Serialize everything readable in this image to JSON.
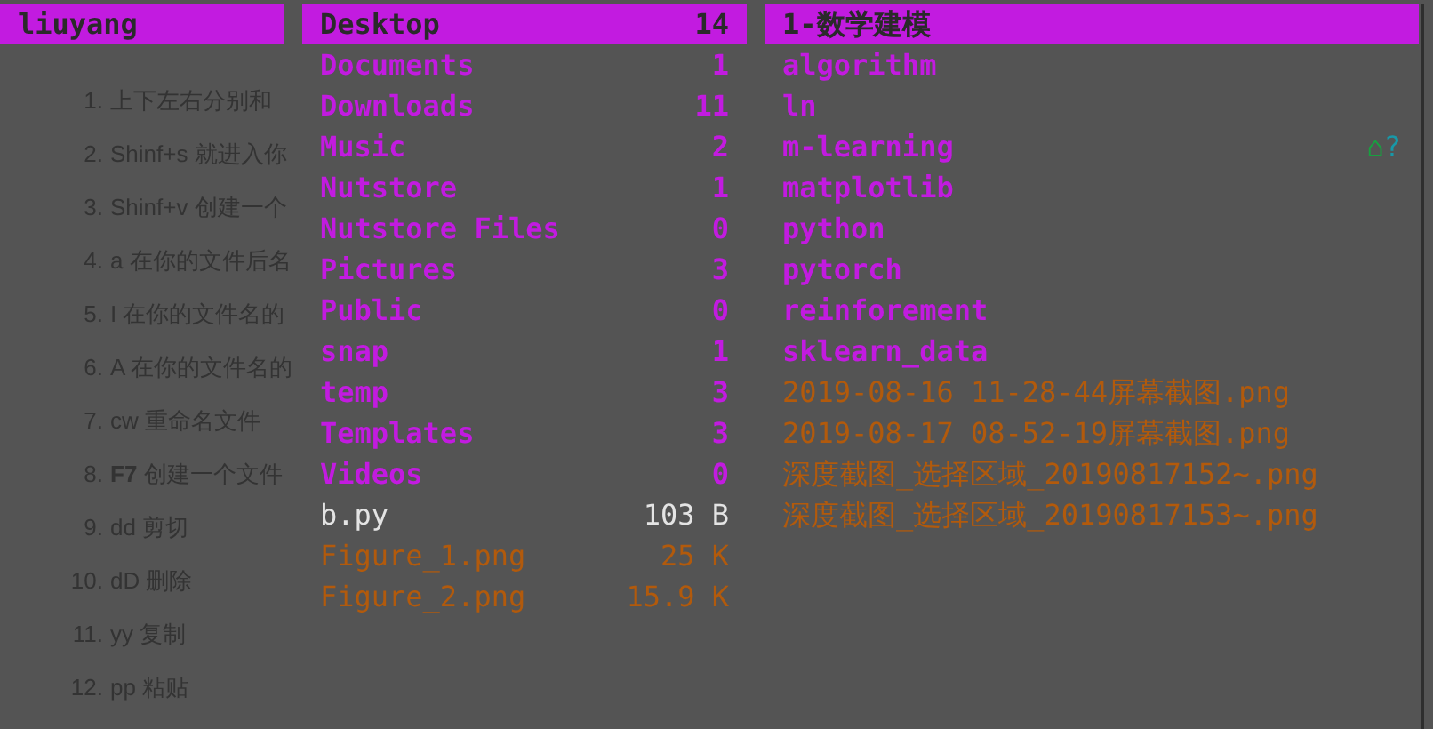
{
  "background_list": [
    {
      "number": "1.",
      "text": "上下左右分别和"
    },
    {
      "number": "2.",
      "text": "Shinf+s 就进入你"
    },
    {
      "number": "3.",
      "text": "Shinf+v 创建一个"
    },
    {
      "number": "4.",
      "text": "a 在你的文件后名"
    },
    {
      "number": "5.",
      "text": "I 在你的文件名的"
    },
    {
      "number": "6.",
      "text": "A 在你的文件名的"
    },
    {
      "number": "7.",
      "text": "cw 重命名文件"
    },
    {
      "number": "8.",
      "text": "**F7** 创建一个文件"
    },
    {
      "number": "9.",
      "text": "dd 剪切"
    },
    {
      "number": "10.",
      "text": "dD 删除"
    },
    {
      "number": "11.",
      "text": "yy 复制"
    },
    {
      "number": "12.",
      "text": "pp 粘贴"
    }
  ],
  "parent_column": {
    "items": [
      {
        "name": "liuyang",
        "kind": "dir",
        "selected": true
      }
    ]
  },
  "current_column": {
    "items": [
      {
        "name": "Desktop",
        "kind": "dir",
        "size": "14",
        "selected": true
      },
      {
        "name": "Documents",
        "kind": "dir",
        "size": "1",
        "selected": false
      },
      {
        "name": "Downloads",
        "kind": "dir",
        "size": "11",
        "selected": false
      },
      {
        "name": "Music",
        "kind": "dir",
        "size": "2",
        "selected": false
      },
      {
        "name": "Nutstore",
        "kind": "dir",
        "size": "1",
        "selected": false
      },
      {
        "name": "Nutstore Files",
        "kind": "dir",
        "size": "0",
        "selected": false
      },
      {
        "name": "Pictures",
        "kind": "dir",
        "size": "3",
        "selected": false
      },
      {
        "name": "Public",
        "kind": "dir",
        "size": "0",
        "selected": false
      },
      {
        "name": "snap",
        "kind": "dir",
        "size": "1",
        "selected": false
      },
      {
        "name": "temp",
        "kind": "dir",
        "size": "3",
        "selected": false
      },
      {
        "name": "Templates",
        "kind": "dir",
        "size": "3",
        "selected": false
      },
      {
        "name": "Videos",
        "kind": "dir",
        "size": "0",
        "selected": false
      },
      {
        "name": "b.py",
        "kind": "file",
        "size": "103 B",
        "selected": false
      },
      {
        "name": "Figure_1.png",
        "kind": "image",
        "size": "25 K",
        "selected": false
      },
      {
        "name": "Figure_2.png",
        "kind": "image",
        "size": "15.9 K",
        "selected": false
      }
    ]
  },
  "preview_column": {
    "items": [
      {
        "name": "1-数学建模",
        "kind": "dir",
        "selected": true
      },
      {
        "name": "algorithm",
        "kind": "dir",
        "selected": false
      },
      {
        "name": "ln",
        "kind": "dir",
        "selected": false
      },
      {
        "name": "m-learning",
        "kind": "dir",
        "selected": false,
        "marks": [
          {
            "text": "⌂",
            "color": "#18a040"
          },
          {
            "text": "?",
            "color": "#1898a8"
          }
        ]
      },
      {
        "name": "matplotlib",
        "kind": "dir",
        "selected": false
      },
      {
        "name": "python",
        "kind": "dir",
        "selected": false
      },
      {
        "name": "pytorch",
        "kind": "dir",
        "selected": false
      },
      {
        "name": "reinforement",
        "kind": "dir",
        "selected": false
      },
      {
        "name": "sklearn_data",
        "kind": "dir",
        "selected": false
      },
      {
        "name": "2019-08-16 11-28-44屏幕截图.png",
        "kind": "image",
        "selected": false
      },
      {
        "name": "2019-08-17 08-52-19屏幕截图.png",
        "kind": "image",
        "selected": false
      },
      {
        "name": "深度截图_选择区域_20190817152~.png",
        "kind": "image",
        "selected": false
      },
      {
        "name": "深度截图_选择区域_20190817153~.png",
        "kind": "image",
        "selected": false
      }
    ]
  }
}
